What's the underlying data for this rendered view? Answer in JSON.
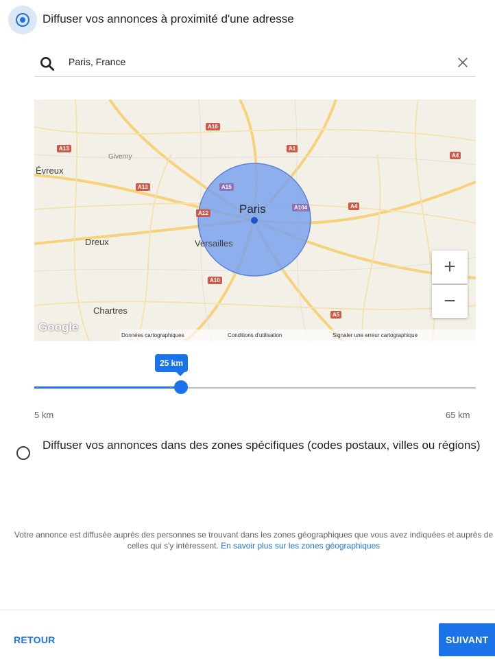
{
  "option_radius": {
    "label": "Diffuser vos annonces à proximité d'une adresse",
    "selected": true
  },
  "search": {
    "value": "Paris, France",
    "icon": "search-icon",
    "clear_icon": "close-icon"
  },
  "map": {
    "labels": {
      "paris": "Paris",
      "versailles": "Versailles",
      "evreux": "Évreux",
      "dreux": "Dreux",
      "chartres": "Chartres",
      "giverny": "Giverny"
    },
    "roads": {
      "a16": "A16",
      "a13_nw": "A13",
      "a1": "A1",
      "a4": "A4",
      "a13_w": "A13",
      "a15": "A15",
      "a104": "A104",
      "a4_e": "A4",
      "a12": "A12",
      "a10": "A10",
      "a5": "A5"
    },
    "zoom_in": "+",
    "zoom_out": "−",
    "logo": "Google",
    "attribution": {
      "data": "Données cartographiques",
      "terms": "Conditions d'utilisation",
      "report": "Signaler une erreur cartographique"
    },
    "radius_color": "#7ba3ef"
  },
  "slider": {
    "value_label": "25 km",
    "min_label": "5 km",
    "max_label": "65 km",
    "value": 25,
    "min": 5,
    "max": 65
  },
  "option_zones": {
    "label": "Diffuser vos annonces dans des zones spécifiques (codes postaux, villes ou régions)",
    "selected": false
  },
  "info": {
    "text": "Votre annonce est diffusée auprès des personnes se trouvant dans les zones géographiques que vous avez indiquées et auprès de celles qui s'y intéressent. ",
    "link": "En savoir plus sur les zones géographiques"
  },
  "footer": {
    "back": "RETOUR",
    "next": "SUIVANT"
  },
  "colors": {
    "accent": "#1a73e8"
  }
}
